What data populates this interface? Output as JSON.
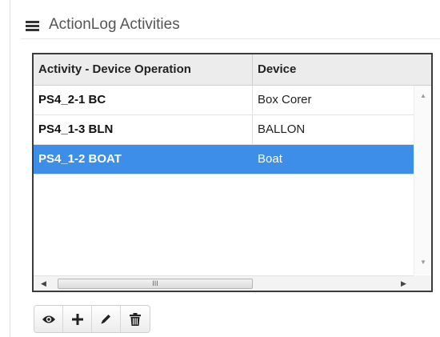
{
  "app": {
    "title": "ActionLog Activities",
    "menu_icon": "hamburger-icon"
  },
  "grid": {
    "columns": [
      "Activity - Device Operation",
      "Device"
    ],
    "rows": [
      {
        "activity": "PS4_2-1 BC",
        "device": "Box Corer",
        "selected": false
      },
      {
        "activity": "PS4_1-3 BLN",
        "device": "BALLON",
        "selected": false
      },
      {
        "activity": "PS4_1-2 BOAT",
        "device": "Boat",
        "selected": true
      }
    ],
    "selection_color": "#3d8ee8",
    "scroll": {
      "up_icon": "triangle-up-icon",
      "down_icon": "triangle-down-icon",
      "left_icon": "triangle-left-icon",
      "right_icon": "triangle-right-icon",
      "thumb_grip": "III"
    }
  },
  "toolbar": {
    "buttons": [
      {
        "name": "view",
        "icon": "eye-icon"
      },
      {
        "name": "add",
        "icon": "plus-icon"
      },
      {
        "name": "edit",
        "icon": "pencil-icon"
      },
      {
        "name": "delete",
        "icon": "trash-icon"
      }
    ]
  }
}
